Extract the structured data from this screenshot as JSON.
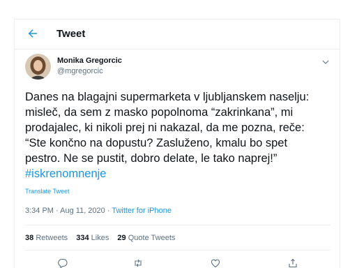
{
  "header": {
    "title": "Tweet",
    "back_icon": "arrow-left-icon"
  },
  "author": {
    "name": "Monika Gregorcic",
    "handle": "@mgregorcic"
  },
  "tweet": {
    "line1": "Danes na blagajni supermarketa v ljubljanskem naselju:",
    "line2": "misleč, da sem z masko popolnoma “zakrinkana”, mi",
    "line3": "prodajalec, ki nikoli prej ni nakazal, da me pozna, reče:",
    "line4": "“Ste končno na dopustu? Zasluženo, kmalu bo spet",
    "line5": "pestro. Ne se pustit, dobro delate, le tako naprej!”",
    "hashtag": "#iskrenomnenje"
  },
  "translate_label": "Translate Tweet",
  "meta": {
    "time": "3:34 PM",
    "separator": " · ",
    "date": "Aug 11, 2020",
    "source": "Twitter for iPhone"
  },
  "stats": {
    "retweets_count": "38",
    "retweets_label": "Retweets",
    "likes_count": "334",
    "likes_label": "Likes",
    "quotes_count": "29",
    "quotes_label": "Quote Tweets"
  },
  "actions": [
    "reply-icon",
    "retweet-icon",
    "like-icon",
    "share-icon"
  ],
  "colors": {
    "accent": "#1b95e0",
    "muted": "#5b7083",
    "text": "#0f1419",
    "border": "#ebeef0"
  }
}
